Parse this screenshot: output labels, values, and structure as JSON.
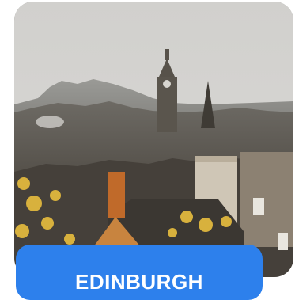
{
  "card": {
    "image": "edinburgh-skyline-photo",
    "city_label": "EDINBURGH"
  },
  "colors": {
    "button": "#2d80ec",
    "button_text": "#ffffff",
    "sky": "#d6d5d2"
  }
}
